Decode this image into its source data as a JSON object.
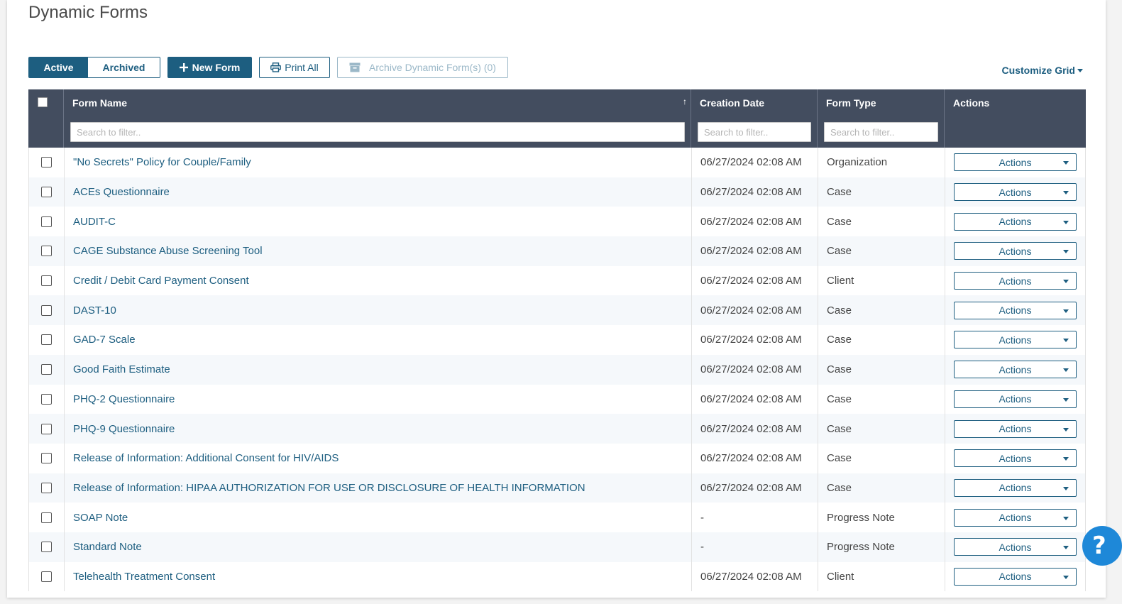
{
  "page": {
    "title": "Dynamic Forms"
  },
  "toolbar": {
    "tab_active": "Active",
    "tab_archived": "Archived",
    "new_form": "New Form",
    "print_all": "Print All",
    "archive": "Archive Dynamic Form(s) (0)",
    "customize_grid": "Customize Grid"
  },
  "grid": {
    "columns": {
      "form_name": "Form Name",
      "creation_date": "Creation Date",
      "form_type": "Form Type",
      "actions": "Actions"
    },
    "filter_placeholder": "Search to filter..",
    "action_label": "Actions",
    "rows": [
      {
        "name": "\"No Secrets\" Policy for Couple/Family",
        "date": "06/27/2024 02:08 AM",
        "type": "Organization"
      },
      {
        "name": "ACEs Questionnaire",
        "date": "06/27/2024 02:08 AM",
        "type": "Case"
      },
      {
        "name": "AUDIT-C",
        "date": "06/27/2024 02:08 AM",
        "type": "Case"
      },
      {
        "name": "CAGE Substance Abuse Screening Tool",
        "date": "06/27/2024 02:08 AM",
        "type": "Case"
      },
      {
        "name": "Credit / Debit Card Payment Consent",
        "date": "06/27/2024 02:08 AM",
        "type": "Client"
      },
      {
        "name": "DAST-10",
        "date": "06/27/2024 02:08 AM",
        "type": "Case"
      },
      {
        "name": "GAD-7 Scale",
        "date": "06/27/2024 02:08 AM",
        "type": "Case"
      },
      {
        "name": "Good Faith Estimate",
        "date": "06/27/2024 02:08 AM",
        "type": "Case"
      },
      {
        "name": "PHQ-2 Questionnaire",
        "date": "06/27/2024 02:08 AM",
        "type": "Case"
      },
      {
        "name": "PHQ-9 Questionnaire",
        "date": "06/27/2024 02:08 AM",
        "type": "Case"
      },
      {
        "name": "Release of Information: Additional Consent for HIV/AIDS",
        "date": "06/27/2024 02:08 AM",
        "type": "Case"
      },
      {
        "name": "Release of Information: HIPAA AUTHORIZATION FOR USE OR DISCLOSURE OF HEALTH INFORMATION",
        "date": "06/27/2024 02:08 AM",
        "type": "Case"
      },
      {
        "name": "SOAP Note",
        "date": "-",
        "type": "Progress Note"
      },
      {
        "name": "Standard Note",
        "date": "-",
        "type": "Progress Note"
      },
      {
        "name": "Telehealth Treatment Consent",
        "date": "06/27/2024 02:08 AM",
        "type": "Client"
      }
    ]
  },
  "help": {
    "label": "?"
  },
  "colors": {
    "primary": "#1d5e80",
    "header_bg": "#434d5f",
    "help": "#1e88d8"
  }
}
